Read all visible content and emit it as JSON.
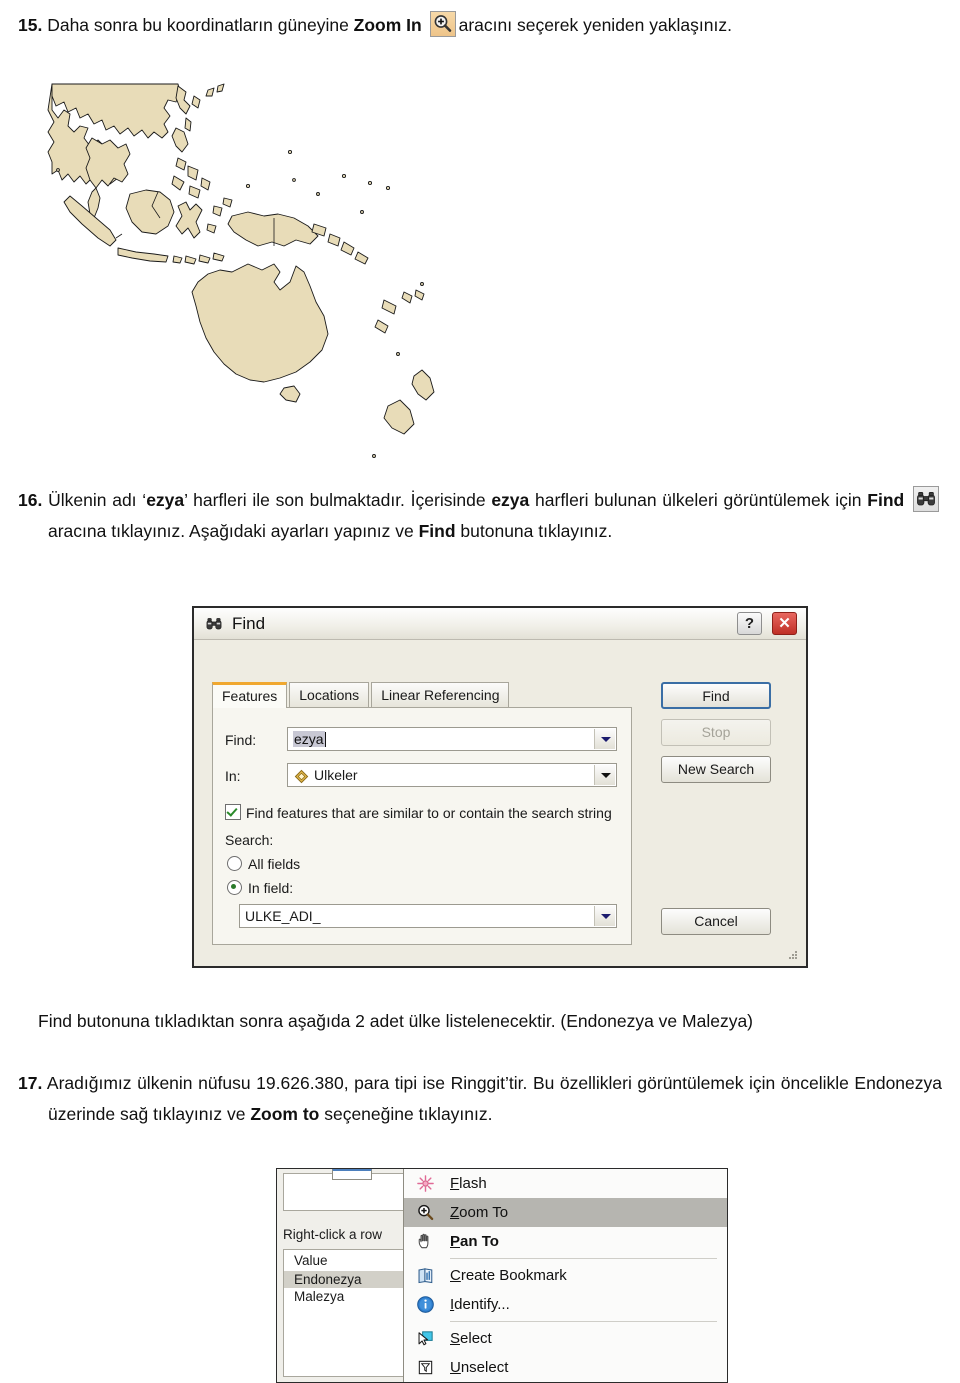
{
  "document": {
    "step15": {
      "number": "15.",
      "text_before_bold": "Daha sonra bu koordinatların güneyine ",
      "bold_term": "Zoom In",
      "icon_name": "zoom-in-icon",
      "text_after_icon": "aracını seçerek yeniden yaklaşınız."
    },
    "step16": {
      "number": "16.",
      "part1": "Ülkenin adı ‘",
      "bold1": "ezya",
      "part2": "’ harfleri ile son bulmaktadır.    İçerisinde ",
      "bold2": "ezya",
      "part3": " harfleri bulunan ülkeleri görüntülemek için ",
      "bold3": "Find",
      "icon_name": "find-binoculars-icon",
      "part4": "aracına tıklayınız.    Aşağıdaki ayarları yapınız ve ",
      "bold4": "Find",
      "part5": " butonuna tıklayınız."
    },
    "note_find": "Find butonuna tıkladıktan sonra aşağıda 2 adet ülke listelenecektir. (Endonezya ve Malezya)",
    "step17": {
      "number": "17.",
      "part1": "Aradığımız ülkenin nüfusu 19.626.380, para tipi ise Ringgit’tir.   Bu özellikleri görüntülemek için öncelikle Endonezya üzerinde sağ tıklayınız ve ",
      "bold1": "Zoom to",
      "part2": " seçeneğine tıklayınız."
    }
  },
  "map": {
    "name": "southeast-asia-oceania-map",
    "land_fill": "#e8dcb8",
    "outline": "#1a1a1a",
    "background": "#ffffff"
  },
  "find_dialog": {
    "title": "Find",
    "title_icon": "binoculars-icon",
    "help_button": "?",
    "close_button": "✕",
    "tabs": [
      {
        "label": "Features",
        "active": true
      },
      {
        "label": "Locations",
        "active": false
      },
      {
        "label": "Linear Referencing",
        "active": false
      }
    ],
    "find_label": "Find:",
    "find_value": "ezya",
    "in_label": "In:",
    "in_value": "Ulkeler",
    "in_layer_symbol": "polygon-layer-icon",
    "similar_checkbox": {
      "checked": true,
      "label": "Find features that are similar to or contain the search string"
    },
    "search_group_label": "Search:",
    "radio_all_fields": {
      "label": "All fields",
      "selected": false
    },
    "radio_in_field": {
      "label": "In field:",
      "selected": true
    },
    "field_value": "ULKE_ADI_",
    "buttons": {
      "find": "Find",
      "stop": "Stop",
      "new_search": "New Search",
      "cancel": "Cancel"
    },
    "colors": {
      "active_tab_accent": "#f0a830",
      "default_button_border": "#3a6ea5",
      "close_button": "#bf2f26",
      "selection_highlight": "#c8c8d4"
    }
  },
  "context_menu_figure": {
    "hint_text": "Right-click a row",
    "table": {
      "header": "Value",
      "rows": [
        {
          "value": "Endonezya",
          "selected": true
        },
        {
          "value": "Malezya",
          "selected": false
        }
      ]
    },
    "menu_items": [
      {
        "label": "Flash",
        "icon": "flash-icon",
        "highlighted": false,
        "bold": false,
        "separator_after": false
      },
      {
        "label": "Zoom To",
        "icon": "zoom-to-icon",
        "highlighted": true,
        "bold": false,
        "separator_after": false
      },
      {
        "label": "Pan To",
        "icon": "pan-hand-icon",
        "highlighted": false,
        "bold": true,
        "separator_after": true
      },
      {
        "label": "Create Bookmark",
        "icon": "bookmark-icon",
        "highlighted": false,
        "bold": false,
        "separator_after": false
      },
      {
        "label": "Identify...",
        "icon": "identify-info-icon",
        "highlighted": false,
        "bold": false,
        "separator_after": true
      },
      {
        "label": "Select",
        "icon": "select-arrow-icon",
        "highlighted": false,
        "bold": false,
        "separator_after": false
      },
      {
        "label": "Unselect",
        "icon": "unselect-icon",
        "highlighted": false,
        "bold": false,
        "separator_after": false
      }
    ],
    "highlight_color": "#b6b5b0"
  }
}
